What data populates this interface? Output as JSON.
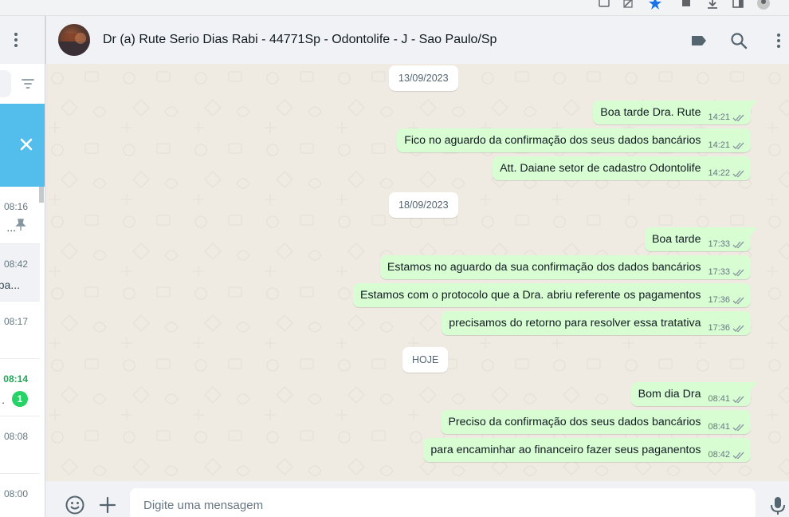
{
  "sidebar": {
    "chats": [
      {
        "time": "08:16",
        "snippet": "...",
        "pinned": true
      },
      {
        "time": "08:42",
        "snippet": "pa...",
        "active": true
      },
      {
        "time": "08:17",
        "snippet": ""
      },
      {
        "time": "08:14",
        "snippet": ".",
        "unread": "1"
      },
      {
        "time": "08:08",
        "snippet": ""
      },
      {
        "time": "08:00",
        "snippet": ""
      }
    ]
  },
  "conversation": {
    "contact_name": "Dr (a) Rute Serio Dias Rabi - 44771Sp - Odontolife - J - Sao Paulo/Sp",
    "dates": [
      "13/09/2023",
      "18/09/2023",
      "HOJE"
    ],
    "messages": [
      {
        "text": "Boa tarde Dra. Rute",
        "time": "14:21"
      },
      {
        "text": "Fico no aguardo da confirmação dos seus dados bancários",
        "time": "14:21"
      },
      {
        "text": "Att. Daiane setor de cadastro Odontolife",
        "time": "14:22"
      },
      {
        "text": "Boa tarde",
        "time": "17:33"
      },
      {
        "text": "Estamos no aguardo da sua confirmação dos dados bancários",
        "time": "17:33"
      },
      {
        "text": "Estamos com o protocolo que a Dra. abriu referente os pagamentos",
        "time": "17:36"
      },
      {
        "text": "precisamos do retorno para resolver essa tratativa",
        "time": "17:36"
      },
      {
        "text": "Bom dia Dra",
        "time": "08:41"
      },
      {
        "text": "Preciso da confirmação dos seus dados bancários",
        "time": "08:41"
      },
      {
        "text": "para encaminhar ao financeiro fazer seus paganentos",
        "time": "08:42"
      }
    ]
  },
  "composer": {
    "placeholder": "Digite uma mensagem"
  },
  "icons": {
    "header": [
      "label-icon",
      "search-icon",
      "menu-dots-icon"
    ],
    "composer": [
      "emoji-icon",
      "attach-plus-icon",
      "microphone-icon"
    ],
    "sidebar": [
      "menu-dots-icon",
      "filter-icon",
      "close-icon",
      "pin-icon"
    ]
  },
  "colors": {
    "outgoing_bubble": "#d9fdd3",
    "chat_background": "#efeae2",
    "banner": "#53bdeb",
    "unread_badge": "#25d366",
    "read_ticks": "#8696a0"
  }
}
